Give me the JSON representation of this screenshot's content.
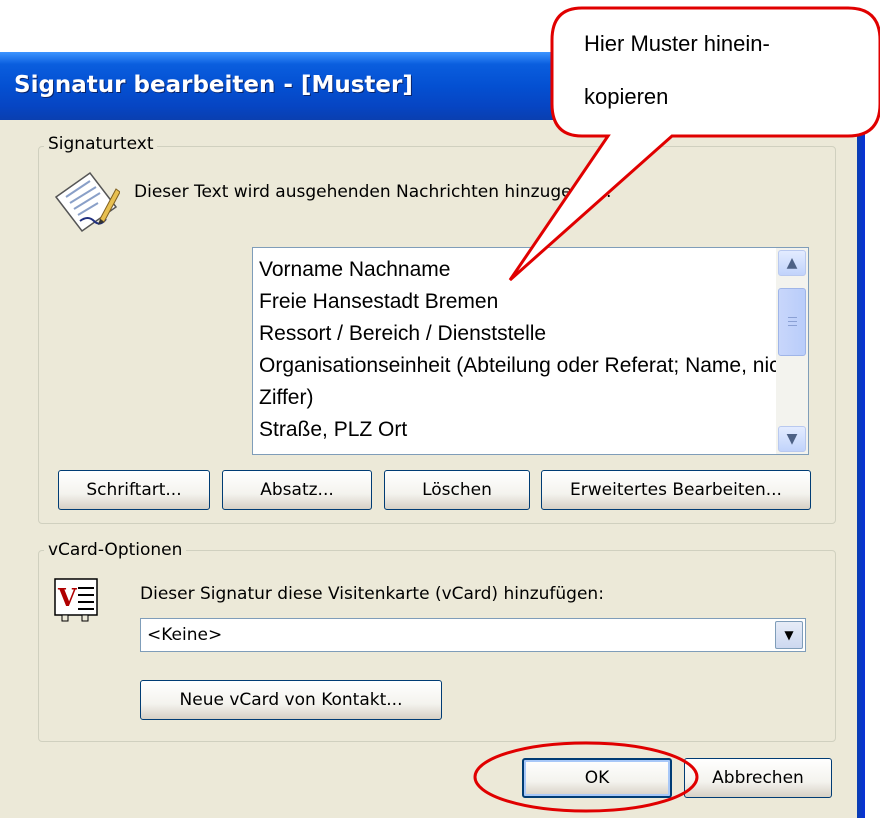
{
  "window": {
    "title": "Signatur bearbeiten - [Muster]"
  },
  "signature_group": {
    "legend": "Signaturtext",
    "description": "Dieser Text wird ausgehenden Nachrichten hinzugefügt:",
    "lines": [
      "Vorname Nachname",
      "Freie Hansestadt Bremen",
      "Ressort / Bereich / Dienststelle",
      "Organisationseinheit (Abteilung oder Referat; Name, nicht nur",
      "Ziffer)",
      "Straße, PLZ Ort"
    ],
    "buttons": {
      "font": "Schriftart...",
      "paragraph": "Absatz...",
      "delete": "Löschen",
      "advanced": "Erweitertes Bearbeiten..."
    }
  },
  "vcard_group": {
    "legend": "vCard-Optionen",
    "description": "Dieser Signatur diese Visitenkarte (vCard) hinzufügen:",
    "selected": "<Keine>",
    "new_button": "Neue vCard von Kontakt..."
  },
  "footer": {
    "ok": "OK",
    "cancel": "Abbrechen"
  },
  "callout": {
    "line1": "Hier Muster hinein-",
    "line2": "kopieren"
  },
  "annotation_color": "#e00000",
  "icons": [
    "signature-pen-icon",
    "vcard-icon",
    "scroll-up-icon",
    "scroll-down-icon",
    "dropdown-arrow-icon"
  ]
}
